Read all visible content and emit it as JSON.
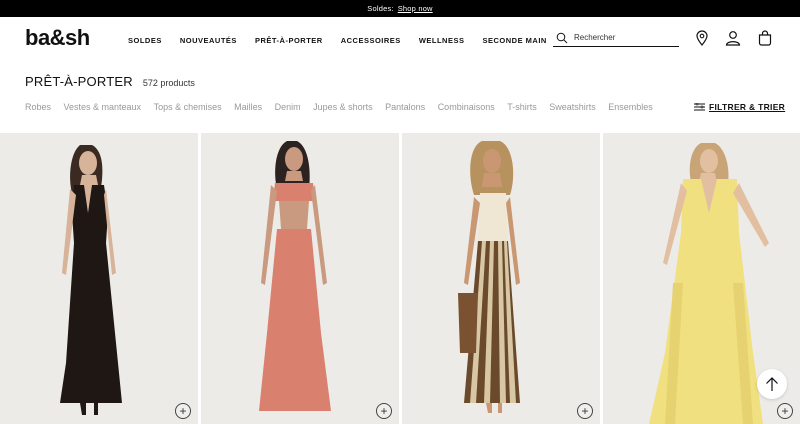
{
  "promo": {
    "text": "Soldes:",
    "link": "Shop now"
  },
  "header": {
    "logo": "ba&sh",
    "nav": [
      "SOLDES",
      "NOUVEAUTÉS",
      "PRÊT-À-PORTER",
      "ACCESSOIRES",
      "WELLNESS",
      "SECONDE MAIN"
    ],
    "search_placeholder": "Rechercher",
    "icons": [
      "location-pin-icon",
      "account-icon",
      "bag-icon"
    ]
  },
  "page": {
    "title": "PRÊT-À-PORTER",
    "count": "572 products"
  },
  "categories": [
    "Robes",
    "Vestes & manteaux",
    "Tops & chemises",
    "Mailles",
    "Denim",
    "Jupes & shorts",
    "Pantalons",
    "Combinaisons",
    "T-shirts",
    "Sweatshirts",
    "Ensembles"
  ],
  "filter_label": "FILTRER & TRIER",
  "products": [
    {
      "image": "black-maxi-dress",
      "add_icon": "+"
    },
    {
      "image": "coral-cutout-maxi-dress",
      "add_icon": "+"
    },
    {
      "image": "striped-knit-maxi-dress",
      "add_icon": "+"
    },
    {
      "image": "yellow-pleated-maxi-dress",
      "add_icon": "+"
    }
  ],
  "colors": {
    "promo_bg": "#000000",
    "photo_bg": "#ecebe7",
    "muted_text": "#999999"
  }
}
